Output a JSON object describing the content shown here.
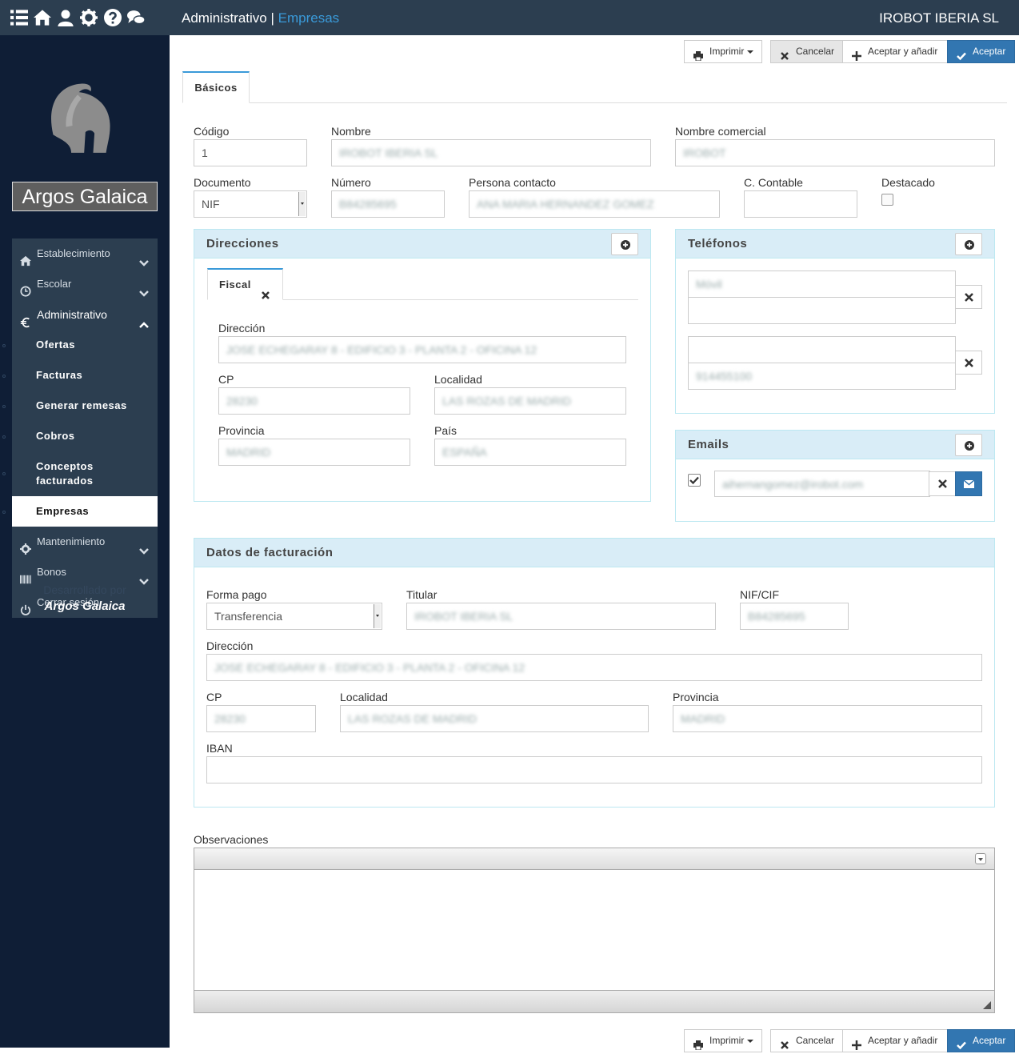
{
  "header": {
    "section": "Administrativo",
    "separator": "|",
    "current": "Empresas",
    "company": "IROBOT IBERIA SL",
    "icons": [
      "list-icon",
      "home-icon",
      "user-icon",
      "gear-icon",
      "question-icon",
      "chat-icon"
    ]
  },
  "sidebar": {
    "logo_text": "Argos Galaica",
    "developed_by": "Desarrollado por",
    "developer": "Argos Galaica",
    "menu": [
      {
        "label": "Establecimiento",
        "icon": "home-icon"
      },
      {
        "label": "Escolar",
        "icon": "clock-icon"
      },
      {
        "label": "Administrativo",
        "icon": "euro-icon"
      },
      {
        "label": "Mantenimiento",
        "icon": "gear-icon"
      },
      {
        "label": "Bonos",
        "icon": "barcode-icon"
      },
      {
        "label": "Cerrar sesión",
        "icon": "power-icon"
      }
    ],
    "submenu": [
      "Ofertas",
      "Facturas",
      "Generar remesas",
      "Cobros",
      "Conceptos facturados",
      "Empresas"
    ]
  },
  "toolbar": {
    "print": "Imprimir",
    "cancel": "Cancelar",
    "accept_add": "Aceptar y añadir",
    "accept": "Aceptar"
  },
  "tabs": {
    "basicos": "Básicos"
  },
  "form": {
    "codigo": {
      "label": "Código",
      "value": "1"
    },
    "nombre": {
      "label": "Nombre",
      "value": "IROBOT IBERIA SL"
    },
    "nombre_comercial": {
      "label": "Nombre comercial",
      "value": "IROBOT"
    },
    "documento": {
      "label": "Documento",
      "value": "NIF"
    },
    "numero": {
      "label": "Número",
      "value": "B84285695"
    },
    "persona_contacto": {
      "label": "Persona contacto",
      "value": "ANA MARIA HERNANDEZ GOMEZ"
    },
    "c_contable": {
      "label": "C. Contable",
      "value": ""
    },
    "destacado": {
      "label": "Destacado"
    }
  },
  "direcciones": {
    "title": "Direcciones",
    "tab": "Fiscal",
    "direccion": {
      "label": "Dirección",
      "value": "JOSE ECHEGARAY 8 - EDIFICIO 3 - PLANTA 2 - OFICINA 12"
    },
    "cp": {
      "label": "CP",
      "value": "28230"
    },
    "localidad": {
      "label": "Localidad",
      "value": "LAS ROZAS DE MADRID"
    },
    "provincia": {
      "label": "Provincia",
      "value": "MADRID"
    },
    "pais": {
      "label": "País",
      "value": "ESPAÑA"
    }
  },
  "telefonos": {
    "title": "Teléfonos",
    "entries": [
      {
        "number": "Móvil",
        "description": ""
      },
      {
        "number": "",
        "description": "914455100"
      }
    ]
  },
  "emails": {
    "title": "Emails",
    "entries": [
      {
        "address": "aihernangomez@irobot.com",
        "checked": true
      }
    ]
  },
  "facturacion": {
    "title": "Datos de facturación",
    "forma_pago": {
      "label": "Forma pago",
      "value": "Transferencia"
    },
    "titular": {
      "label": "Titular",
      "value": "IROBOT IBERIA SL"
    },
    "nif": {
      "label": "NIF/CIF",
      "value": "B84285695"
    },
    "direccion": {
      "label": "Dirección",
      "value": "JOSE ECHEGARAY 8 - EDIFICIO 3 - PLANTA 2 - OFICINA 12"
    },
    "cp": {
      "label": "CP",
      "value": "28230"
    },
    "localidad": {
      "label": "Localidad",
      "value": "LAS ROZAS DE MADRID"
    },
    "provincia": {
      "label": "Provincia",
      "value": "MADRID"
    },
    "iban": {
      "label": "IBAN",
      "value": ""
    }
  },
  "observaciones": {
    "label": "Observaciones",
    "value": ""
  },
  "colors": {
    "header": "#2c3e50",
    "sidebar": "#0f1e36",
    "accent": "#3a9ad9",
    "primary": "#3276b1",
    "panel": "#d9edf7"
  }
}
